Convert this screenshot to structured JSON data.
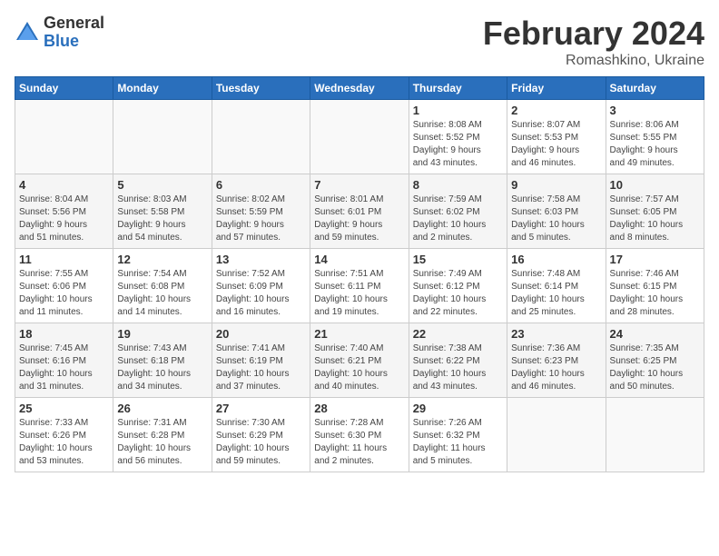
{
  "header": {
    "logo_general": "General",
    "logo_blue": "Blue",
    "month_title": "February 2024",
    "location": "Romashkino, Ukraine"
  },
  "weekdays": [
    "Sunday",
    "Monday",
    "Tuesday",
    "Wednesday",
    "Thursday",
    "Friday",
    "Saturday"
  ],
  "weeks": [
    [
      {
        "day": "",
        "info": ""
      },
      {
        "day": "",
        "info": ""
      },
      {
        "day": "",
        "info": ""
      },
      {
        "day": "",
        "info": ""
      },
      {
        "day": "1",
        "info": "Sunrise: 8:08 AM\nSunset: 5:52 PM\nDaylight: 9 hours\nand 43 minutes."
      },
      {
        "day": "2",
        "info": "Sunrise: 8:07 AM\nSunset: 5:53 PM\nDaylight: 9 hours\nand 46 minutes."
      },
      {
        "day": "3",
        "info": "Sunrise: 8:06 AM\nSunset: 5:55 PM\nDaylight: 9 hours\nand 49 minutes."
      }
    ],
    [
      {
        "day": "4",
        "info": "Sunrise: 8:04 AM\nSunset: 5:56 PM\nDaylight: 9 hours\nand 51 minutes."
      },
      {
        "day": "5",
        "info": "Sunrise: 8:03 AM\nSunset: 5:58 PM\nDaylight: 9 hours\nand 54 minutes."
      },
      {
        "day": "6",
        "info": "Sunrise: 8:02 AM\nSunset: 5:59 PM\nDaylight: 9 hours\nand 57 minutes."
      },
      {
        "day": "7",
        "info": "Sunrise: 8:01 AM\nSunset: 6:01 PM\nDaylight: 9 hours\nand 59 minutes."
      },
      {
        "day": "8",
        "info": "Sunrise: 7:59 AM\nSunset: 6:02 PM\nDaylight: 10 hours\nand 2 minutes."
      },
      {
        "day": "9",
        "info": "Sunrise: 7:58 AM\nSunset: 6:03 PM\nDaylight: 10 hours\nand 5 minutes."
      },
      {
        "day": "10",
        "info": "Sunrise: 7:57 AM\nSunset: 6:05 PM\nDaylight: 10 hours\nand 8 minutes."
      }
    ],
    [
      {
        "day": "11",
        "info": "Sunrise: 7:55 AM\nSunset: 6:06 PM\nDaylight: 10 hours\nand 11 minutes."
      },
      {
        "day": "12",
        "info": "Sunrise: 7:54 AM\nSunset: 6:08 PM\nDaylight: 10 hours\nand 14 minutes."
      },
      {
        "day": "13",
        "info": "Sunrise: 7:52 AM\nSunset: 6:09 PM\nDaylight: 10 hours\nand 16 minutes."
      },
      {
        "day": "14",
        "info": "Sunrise: 7:51 AM\nSunset: 6:11 PM\nDaylight: 10 hours\nand 19 minutes."
      },
      {
        "day": "15",
        "info": "Sunrise: 7:49 AM\nSunset: 6:12 PM\nDaylight: 10 hours\nand 22 minutes."
      },
      {
        "day": "16",
        "info": "Sunrise: 7:48 AM\nSunset: 6:14 PM\nDaylight: 10 hours\nand 25 minutes."
      },
      {
        "day": "17",
        "info": "Sunrise: 7:46 AM\nSunset: 6:15 PM\nDaylight: 10 hours\nand 28 minutes."
      }
    ],
    [
      {
        "day": "18",
        "info": "Sunrise: 7:45 AM\nSunset: 6:16 PM\nDaylight: 10 hours\nand 31 minutes."
      },
      {
        "day": "19",
        "info": "Sunrise: 7:43 AM\nSunset: 6:18 PM\nDaylight: 10 hours\nand 34 minutes."
      },
      {
        "day": "20",
        "info": "Sunrise: 7:41 AM\nSunset: 6:19 PM\nDaylight: 10 hours\nand 37 minutes."
      },
      {
        "day": "21",
        "info": "Sunrise: 7:40 AM\nSunset: 6:21 PM\nDaylight: 10 hours\nand 40 minutes."
      },
      {
        "day": "22",
        "info": "Sunrise: 7:38 AM\nSunset: 6:22 PM\nDaylight: 10 hours\nand 43 minutes."
      },
      {
        "day": "23",
        "info": "Sunrise: 7:36 AM\nSunset: 6:23 PM\nDaylight: 10 hours\nand 46 minutes."
      },
      {
        "day": "24",
        "info": "Sunrise: 7:35 AM\nSunset: 6:25 PM\nDaylight: 10 hours\nand 50 minutes."
      }
    ],
    [
      {
        "day": "25",
        "info": "Sunrise: 7:33 AM\nSunset: 6:26 PM\nDaylight: 10 hours\nand 53 minutes."
      },
      {
        "day": "26",
        "info": "Sunrise: 7:31 AM\nSunset: 6:28 PM\nDaylight: 10 hours\nand 56 minutes."
      },
      {
        "day": "27",
        "info": "Sunrise: 7:30 AM\nSunset: 6:29 PM\nDaylight: 10 hours\nand 59 minutes."
      },
      {
        "day": "28",
        "info": "Sunrise: 7:28 AM\nSunset: 6:30 PM\nDaylight: 11 hours\nand 2 minutes."
      },
      {
        "day": "29",
        "info": "Sunrise: 7:26 AM\nSunset: 6:32 PM\nDaylight: 11 hours\nand 5 minutes."
      },
      {
        "day": "",
        "info": ""
      },
      {
        "day": "",
        "info": ""
      }
    ]
  ]
}
